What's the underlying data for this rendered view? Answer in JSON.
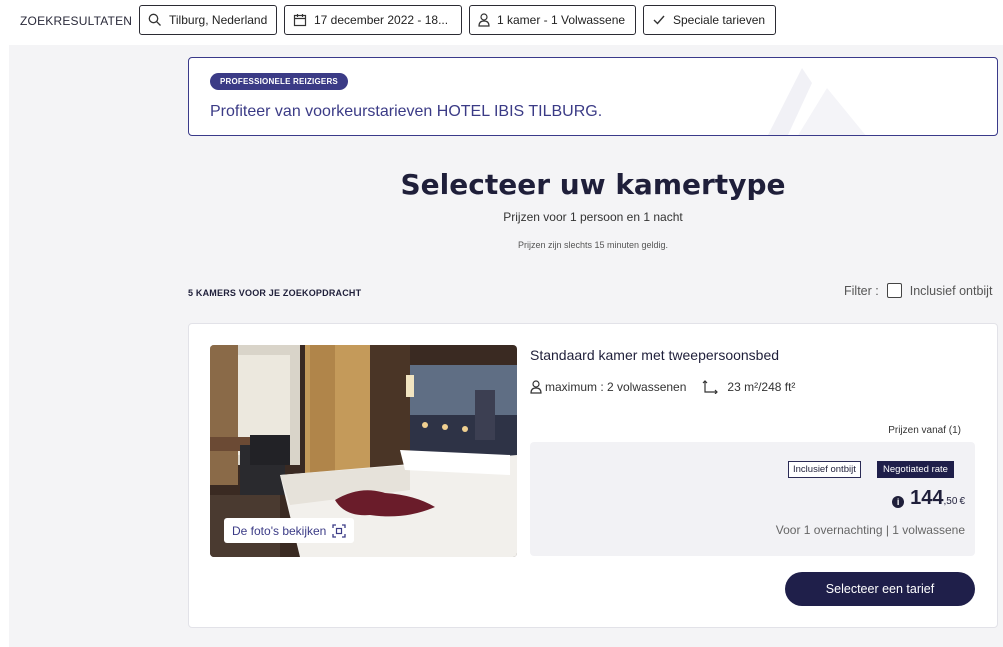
{
  "topbar": {
    "breadcrumb": "ZOEKRESULTATEN",
    "location": "Tilburg, Nederland",
    "dates": "17 december 2022 - 18...",
    "guests": "1 kamer - 1 Volwassene",
    "special_rates": "Speciale tarieven"
  },
  "promo": {
    "badge": "PROFESSIONELE REIZIGERS",
    "text": "Profiteer van voorkeurstarieven HOTEL IBIS TILBURG."
  },
  "heading": {
    "title": "Selecteer uw kamertype",
    "subtitle": "Prijzen voor 1 persoon en 1 nacht",
    "note": "Prijzen zijn slechts 15 minuten geldig."
  },
  "results": {
    "count_label": "5 KAMERS VOOR JE ZOEKOPDRACHT",
    "filter_label": "Filter :",
    "filter_option": "Inclusief ontbijt",
    "filter_checked": false
  },
  "room": {
    "photo_button": "De foto's bekijken",
    "name": "Standaard kamer met tweepersoonsbed",
    "capacity": "maximum : 2 volwassenen",
    "size": "23 m²/248 ft²",
    "prices_from": "Prijzen vanaf (1)",
    "tag_breakfast": "Inclusief ontbijt",
    "tag_rate": "Negotiated rate",
    "price_int": "144",
    "price_dec": ",50",
    "currency": "€",
    "price_note": "Voor 1 overnachting | 1 volwassene",
    "select_button": "Selecteer een tarief"
  },
  "icons": {
    "location": "search-icon",
    "dates": "calendar-icon",
    "guests": "person-icon",
    "special_rates": "check-icon",
    "photo": "expand-icon",
    "capacity": "person-icon",
    "size": "area-icon",
    "price": "info-icon"
  },
  "colors": {
    "accent": "#1f1f4a",
    "promo_accent": "#3b3b86",
    "background": "#f4f4f6"
  }
}
